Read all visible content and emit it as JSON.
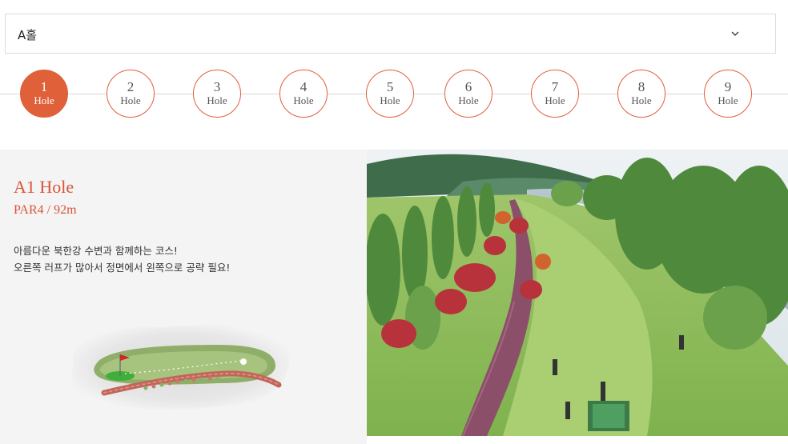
{
  "select": {
    "value": "A홀",
    "icon": "chevron-down-icon"
  },
  "holes": [
    {
      "num": "1",
      "label": "Hole",
      "active": true
    },
    {
      "num": "2",
      "label": "Hole"
    },
    {
      "num": "3",
      "label": "Hole"
    },
    {
      "num": "4",
      "label": "Hole"
    },
    {
      "num": "5",
      "label": "Hole"
    },
    {
      "num": "6",
      "label": "Hole"
    },
    {
      "num": "7",
      "label": "Hole"
    },
    {
      "num": "8",
      "label": "Hole"
    },
    {
      "num": "9",
      "label": "Hole"
    }
  ],
  "info": {
    "title": "A1 Hole",
    "par": "PAR4 / 92m",
    "desc_line1": "아름다운 북한강 수변과 함께하는 코스!",
    "desc_line2": "오른쪽 러프가 많아서 정면에서 왼쪽으로 공략 필요!"
  },
  "colors": {
    "accent": "#e0603a",
    "title": "#d8553a",
    "panel_bg": "#f4f4f4"
  }
}
